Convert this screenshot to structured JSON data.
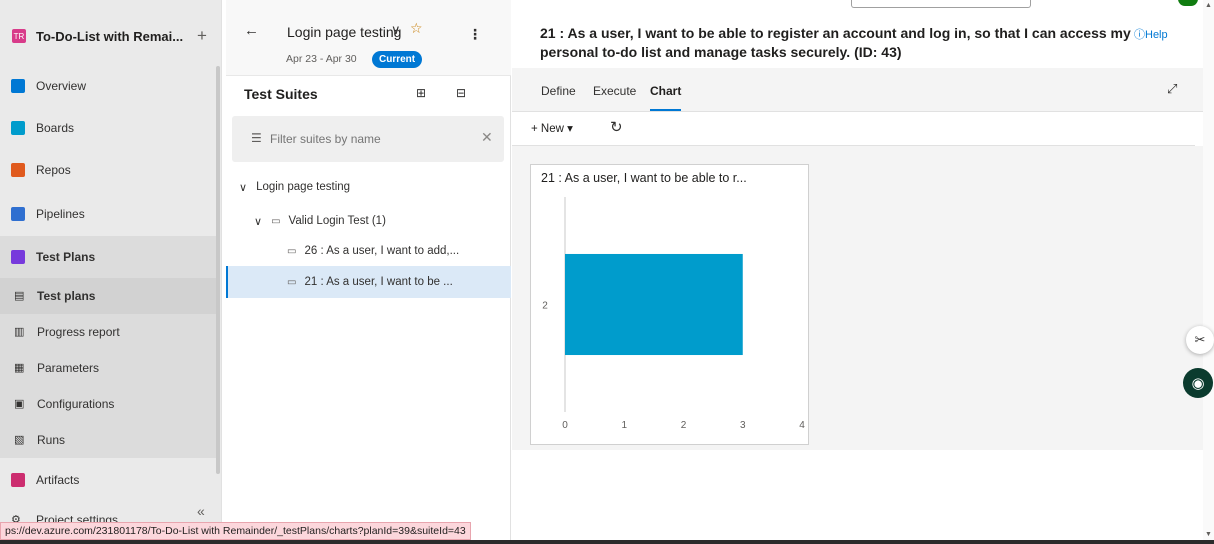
{
  "project": {
    "avatar": "TR",
    "name": "To-Do-List with Remai...",
    "add_label": "+"
  },
  "nav": [
    {
      "label": "Overview",
      "icon": "overview-icon",
      "color": "#0078d4"
    },
    {
      "label": "Boards",
      "icon": "boards-icon",
      "color": "#009ccc"
    },
    {
      "label": "Repos",
      "icon": "repos-icon",
      "color": "#e05a1e"
    },
    {
      "label": "Pipelines",
      "icon": "pipelines-icon",
      "color": "#2f6fd0"
    },
    {
      "label": "Test Plans",
      "icon": "test-plans-icon",
      "color": "#773adc"
    },
    {
      "label": "Test plans",
      "icon": "test-plans-sub-icon"
    },
    {
      "label": "Progress report",
      "icon": "progress-report-icon"
    },
    {
      "label": "Parameters",
      "icon": "parameters-icon"
    },
    {
      "label": "Configurations",
      "icon": "configurations-icon"
    },
    {
      "label": "Runs",
      "icon": "runs-icon"
    },
    {
      "label": "Artifacts",
      "icon": "artifacts-icon",
      "color": "#cc2d6f"
    },
    {
      "label": "Project settings",
      "icon": "settings-icon"
    }
  ],
  "collapse_label": "«",
  "plan": {
    "title": "Login page testing",
    "dates": "Apr 23 - Apr 30",
    "badge": "Current"
  },
  "suites": {
    "title": "Test Suites",
    "filter_placeholder": "Filter suites by name",
    "tree": [
      {
        "label": "Login page testing"
      },
      {
        "label": "Valid Login Test (1)"
      },
      {
        "label": "26 : As a user, I want to add,..."
      },
      {
        "label": "21 : As a user, I want to be ..."
      }
    ]
  },
  "work_item": {
    "title": "21 : As a user, I want to be able to register an account and log in, so that I can access my personal to-do list and manage tasks securely. (ID: 43)",
    "help": "Help"
  },
  "tabs": [
    {
      "label": "Define"
    },
    {
      "label": "Execute"
    },
    {
      "label": "Chart"
    }
  ],
  "toolbar": {
    "new_label": "New"
  },
  "chart_data": {
    "type": "bar",
    "orientation": "horizontal",
    "title": "21 : As a user, I want to be able to r...",
    "categories": [
      "2"
    ],
    "values": [
      3
    ],
    "xlim": [
      0,
      4
    ],
    "xticks": [
      "0",
      "1",
      "2",
      "3",
      "4"
    ],
    "color": "#009ccc",
    "grid": false
  },
  "status_url": "ps://dev.azure.com/231801178/To-Do-List with Remainder/_testPlans/charts?planId=39&suiteId=43"
}
